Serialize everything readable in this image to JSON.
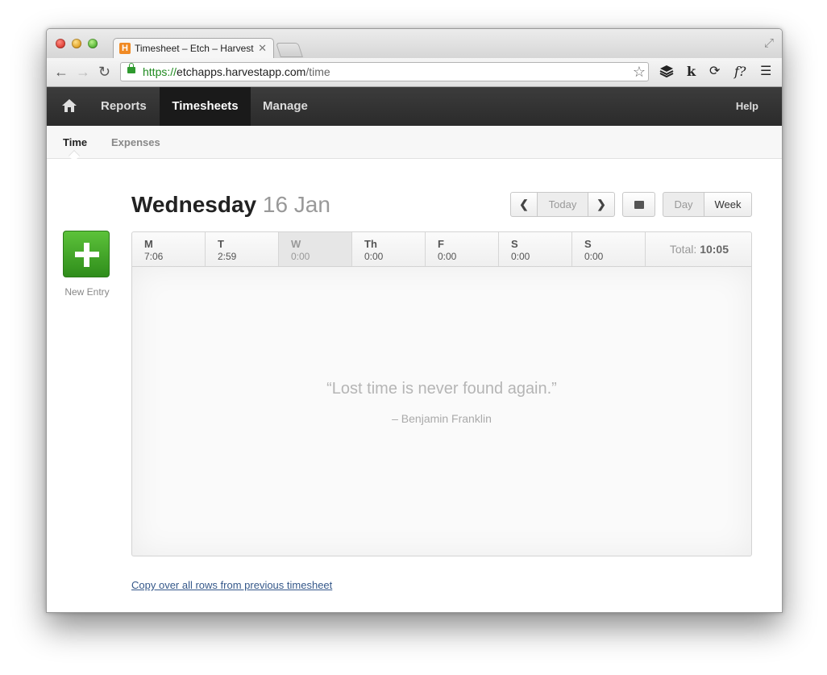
{
  "browser": {
    "tab_title": "Timesheet – Etch – Harvest",
    "tab_favicon_letter": "H",
    "url_scheme": "https://",
    "url_host": "etchapps.harvestapp.com",
    "url_path": "/time",
    "extensions": [
      "layers-icon",
      "k",
      "sync-icon",
      "f?",
      "menu-icon"
    ],
    "ext_k": "k",
    "ext_f": "f?"
  },
  "nav": {
    "reports": "Reports",
    "timesheets": "Timesheets",
    "manage": "Manage",
    "help": "Help",
    "active": "Timesheets"
  },
  "subnav": {
    "time": "Time",
    "expenses": "Expenses",
    "active": "Time"
  },
  "new_entry": {
    "label": "New Entry"
  },
  "header": {
    "day_name": "Wednesday",
    "date": "16 Jan",
    "today_label": "Today",
    "day_label": "Day",
    "week_label": "Week",
    "active_view": "Day"
  },
  "week": {
    "days": [
      {
        "name": "M",
        "time": "7:06"
      },
      {
        "name": "T",
        "time": "2:59"
      },
      {
        "name": "W",
        "time": "0:00"
      },
      {
        "name": "Th",
        "time": "0:00"
      },
      {
        "name": "F",
        "time": "0:00"
      },
      {
        "name": "S",
        "time": "0:00"
      },
      {
        "name": "S",
        "time": "0:00"
      }
    ],
    "active_index": 2,
    "total_label": "Total:",
    "total_value": "10:05"
  },
  "empty_state": {
    "quote": "“Lost time is never found again.”",
    "author": "– Benjamin Franklin"
  },
  "footer": {
    "copy_link": "Copy over all rows from previous timesheet"
  },
  "colors": {
    "accent_green": "#3fa528",
    "nav_dark": "#2f2f2f",
    "link_blue": "#35588a"
  }
}
